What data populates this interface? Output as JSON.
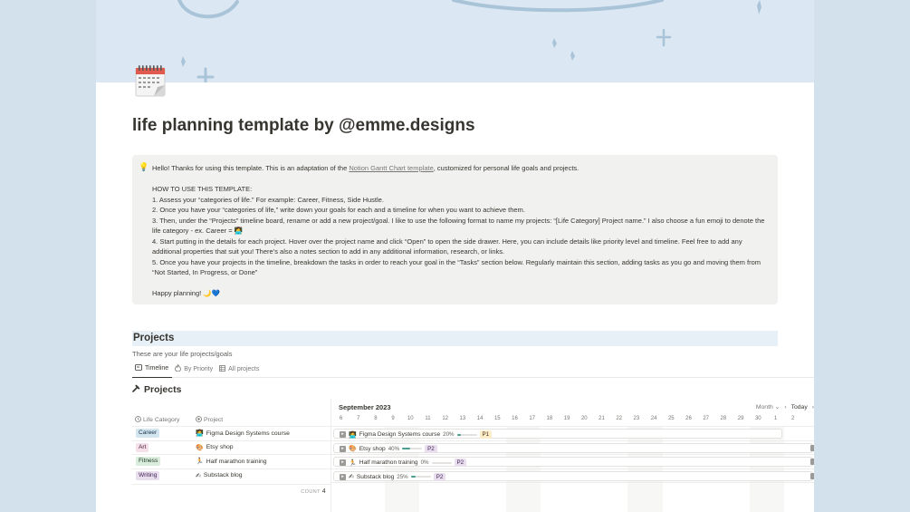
{
  "page": {
    "title": "life planning template by @emme.designs",
    "icon": "calendar-icon"
  },
  "callout": {
    "icon": "lightbulb-icon",
    "intro_before": "Hello! Thanks for using this template. This is an adaptation of the ",
    "intro_link": "Notion Gantt Chart template",
    "intro_after": ", customized for personal life goals and projects.",
    "howto_heading": "HOW TO USE THIS TEMPLATE:",
    "steps": [
      "1. Assess your “categories of life.” For example: Career, Fitness, Side Hustle.",
      "2. Once you have your “categories of life,” write down your goals for each and a timeline for when you want to achieve them.",
      "3. Then, under the “Projects” timeline board, rename or add a new project/goal. I like to use the following format to name my projects: “[Life Category] Project name.” I also choose a fun emoji to denote the life category - ex. Career = 👩‍💻",
      "4. Start putting in the details for each project. Hover over the project name and click “Open” to open the side drawer. Here, you can include details like priority level and timeline. Feel free to add any additional properties that suit you! There’s also a notes section to add in any additional information, research, or links.",
      "5. Once you have your projects in the timeline, breakdown the tasks in order to reach your goal in the “Tasks” section below. Regularly maintain this section, adding tasks as you go and moving them from “Not Started, In Progress, or Done”"
    ],
    "signoff": "Happy planning! 🌙💙"
  },
  "projects_section": {
    "heading": "Projects",
    "description": "These are your life projects/goals",
    "tabs": [
      {
        "label": "Timeline",
        "icon": "timeline-icon",
        "active": true
      },
      {
        "label": "By Priority",
        "icon": "fire-icon",
        "active": false
      },
      {
        "label": "All projects",
        "icon": "table-icon",
        "active": false
      }
    ],
    "database_title": "Projects",
    "columns": {
      "category": "Life Category",
      "project": "Project"
    },
    "rows": [
      {
        "category": "Career",
        "category_bg": "#d3e5ef",
        "category_fg": "#183347",
        "emoji": "👩‍💻",
        "project": "Figma Design Systems course",
        "percent": "20%",
        "progress": 0.2,
        "priority": "P1",
        "priority_bg": "#fdecc8",
        "priority_fg": "#402c1b"
      },
      {
        "category": "Art",
        "category_bg": "#f5e0e9",
        "category_fg": "#4c2337",
        "emoji": "🎨",
        "project": "Etsy shop",
        "percent": "40%",
        "progress": 0.4,
        "priority": "P2",
        "priority_bg": "#e8deee",
        "priority_fg": "#412454"
      },
      {
        "category": "Fitness",
        "category_bg": "#dbeddb",
        "category_fg": "#1c3829",
        "emoji": "🏃",
        "project": "Half marathon training",
        "percent": "0%",
        "progress": 0.0,
        "priority": "P2",
        "priority_bg": "#e8deee",
        "priority_fg": "#412454"
      },
      {
        "category": "Writing",
        "category_bg": "#e8deee",
        "category_fg": "#412454",
        "emoji": "✍",
        "project": "Substack blog",
        "percent": "25%",
        "progress": 0.25,
        "priority": "P2",
        "priority_bg": "#e8deee",
        "priority_fg": "#412454"
      }
    ],
    "count_label": "COUNT",
    "count_value": "4",
    "timeline": {
      "month": "September 2023",
      "scale": "Month",
      "today_label": "Today",
      "days": [
        "6",
        "7",
        "8",
        "9",
        "10",
        "11",
        "12",
        "13",
        "14",
        "15",
        "16",
        "17",
        "18",
        "19",
        "20",
        "21",
        "22",
        "23",
        "24",
        "25",
        "26",
        "27",
        "28",
        "29",
        "30",
        "1",
        "2"
      ]
    }
  }
}
